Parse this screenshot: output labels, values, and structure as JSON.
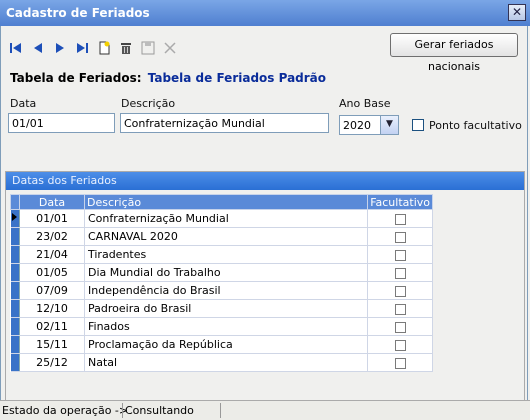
{
  "window": {
    "title": "Cadastro de Feriados"
  },
  "toolbar": {
    "icons": [
      "first-icon",
      "prior-icon",
      "next-icon",
      "last-icon",
      "new-icon",
      "delete-icon",
      "save-icon",
      "cancel-icon"
    ],
    "gerar_label": "Gerar feriados nacionais"
  },
  "tabela": {
    "label": "Tabela de Feriados:",
    "name": "Tabela de Feriados Padrão"
  },
  "form": {
    "data_label": "Data",
    "data_value": "01/01",
    "descricao_label": "Descrição",
    "descricao_value": "Confraternização Mundial",
    "ano_label": "Ano Base",
    "ano_value": "2020",
    "ponto_label": "Ponto facultativo"
  },
  "group": {
    "title": "Datas dos Feriados"
  },
  "grid": {
    "headers": [
      "Data",
      "Descrição",
      "Facultativo"
    ],
    "rows": [
      {
        "data": "01/01",
        "desc": "Confraternização Mundial"
      },
      {
        "data": "23/02",
        "desc": "CARNAVAL 2020"
      },
      {
        "data": "21/04",
        "desc": "Tiradentes"
      },
      {
        "data": "01/05",
        "desc": "Dia Mundial do Trabalho"
      },
      {
        "data": "07/09",
        "desc": "Independência do Brasil"
      },
      {
        "data": "12/10",
        "desc": "Padroeira do Brasil"
      },
      {
        "data": "02/11",
        "desc": "Finados"
      },
      {
        "data": "15/11",
        "desc": "Proclamação da República"
      },
      {
        "data": "25/12",
        "desc": "Natal"
      }
    ]
  },
  "status": {
    "label": "Estado da operação ->",
    "value": "Consultando"
  }
}
